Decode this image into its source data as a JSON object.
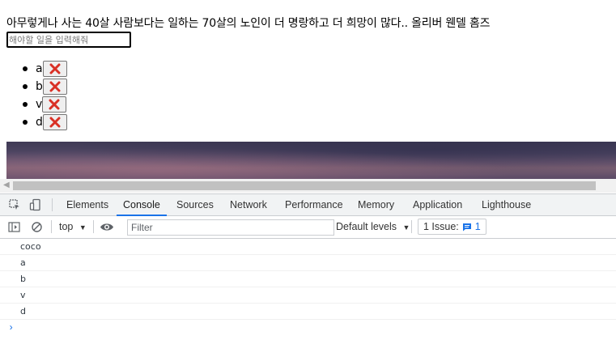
{
  "page": {
    "quote": "아무렇게나 사는 40살 사람보다는 일하는 70살의 노인이 더 명랑하고 더 희망이 많다.. 올리버 웬델 홈즈",
    "input_placeholder": "해야할 일을 입력해줘",
    "todos": [
      {
        "text": "a"
      },
      {
        "text": "b"
      },
      {
        "text": "v"
      },
      {
        "text": "d"
      }
    ],
    "delete_icon": "red-x-icon",
    "delete_color": "#d93025"
  },
  "devtools": {
    "tabs": [
      "Elements",
      "Console",
      "Sources",
      "Network",
      "Performance",
      "Memory",
      "Application",
      "Lighthouse"
    ],
    "active_tab": "Console",
    "context": "top",
    "filter_placeholder": "Filter",
    "levels": "Default levels",
    "issues_label": "1 Issue:",
    "issues_count": "1",
    "logs": [
      "coco",
      "a",
      "b",
      "v",
      "d"
    ],
    "prompt": "›",
    "accent": "#1a73e8"
  }
}
